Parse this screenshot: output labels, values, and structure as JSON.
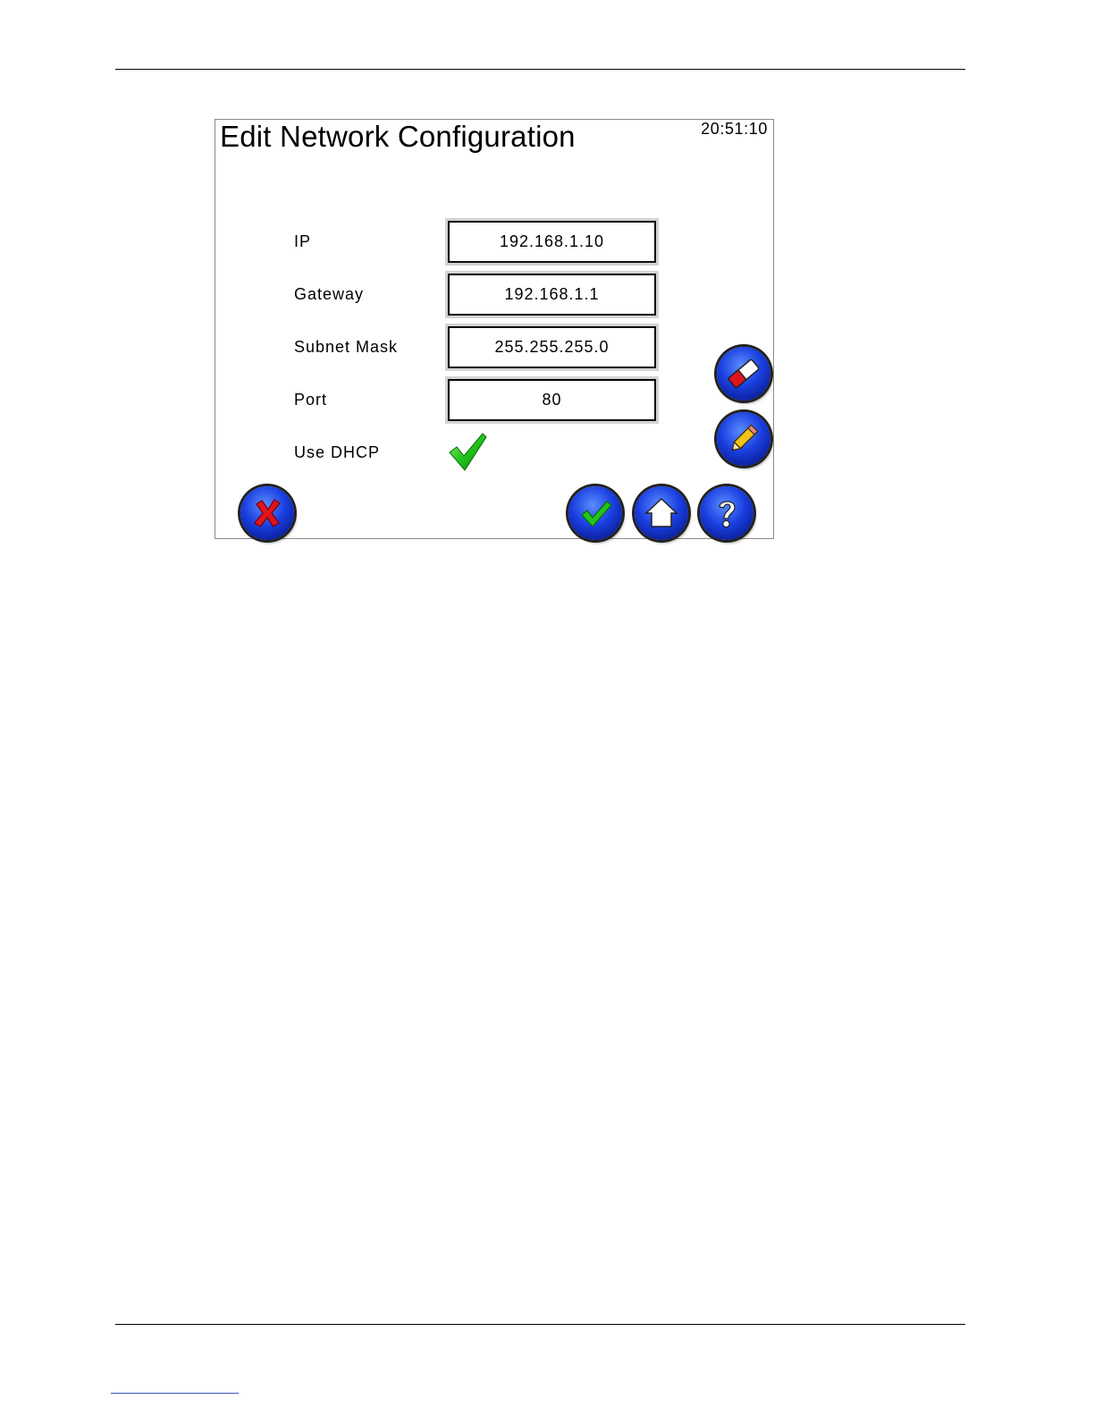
{
  "screen": {
    "title": "Edit Network Configuration",
    "clock": "20:51:10"
  },
  "fields": [
    {
      "label": "IP",
      "value": "192.168.1.10"
    },
    {
      "label": "Gateway",
      "value": "192.168.1.1"
    },
    {
      "label": "Subnet Mask",
      "value": "255.255.255.0"
    },
    {
      "label": "Port",
      "value": "80"
    }
  ],
  "dhcp": {
    "label": "Use DHCP",
    "checked": true,
    "icon": "green-checkmark-icon"
  },
  "buttons": {
    "eraser": {
      "icon": "eraser-icon"
    },
    "pencil": {
      "icon": "pencil-icon"
    },
    "cancel": {
      "icon": "red-x-icon"
    },
    "accept": {
      "icon": "green-check-icon"
    },
    "home": {
      "icon": "home-icon"
    },
    "help": {
      "icon": "question-mark-icon"
    }
  },
  "colors": {
    "button_blue": "#1a3fe0",
    "check_green": "#22c41a",
    "cancel_red": "#e0141e"
  }
}
